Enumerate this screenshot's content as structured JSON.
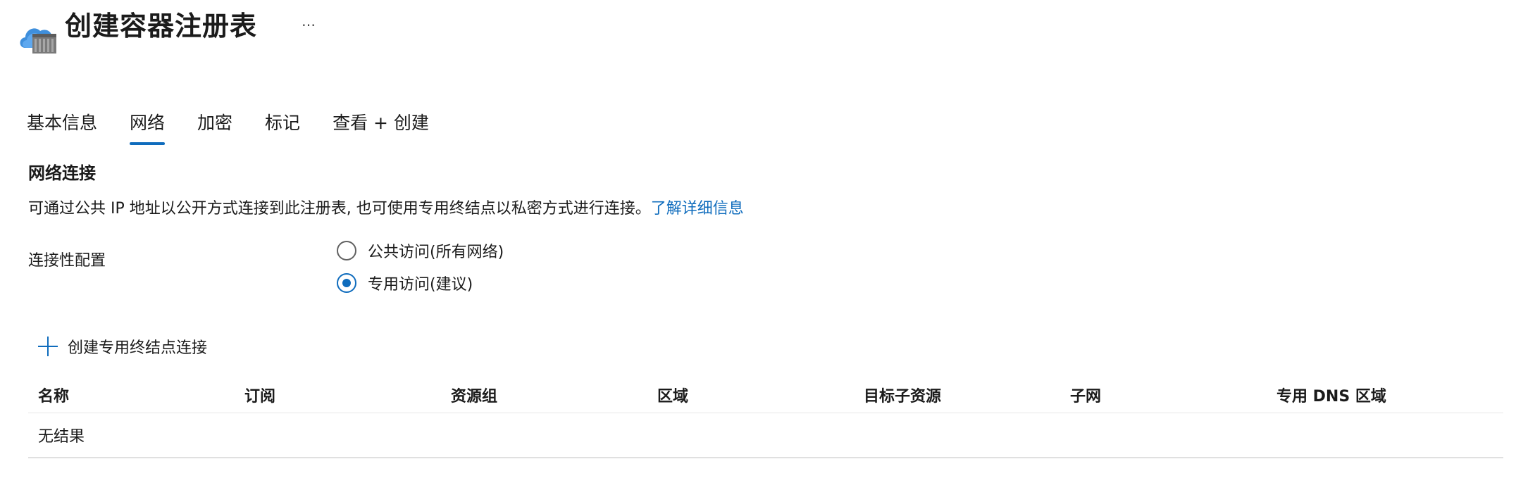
{
  "header": {
    "icon": "container-registry-cloud-icon",
    "title": "创建容器注册表",
    "more": "…"
  },
  "tabs": [
    {
      "label": "基本信息"
    },
    {
      "label": "网络",
      "active": true
    },
    {
      "label": "加密"
    },
    {
      "label": "标记"
    },
    {
      "label": "查看 + 创建"
    }
  ],
  "network": {
    "section_title": "网络连接",
    "description": "可通过公共 IP 地址以公开方式连接到此注册表, 也可使用专用终结点以私密方式进行连接。",
    "learn_more": "了解详细信息",
    "connectivity_label": "连接性配置",
    "options": [
      {
        "label": "公共访问(所有网络)",
        "selected": false
      },
      {
        "label": "专用访问(建议)",
        "selected": true
      }
    ]
  },
  "endpoints": {
    "add_label": "创建专用终结点连接",
    "columns": [
      "名称",
      "订阅",
      "资源组",
      "区域",
      "目标子资源",
      "子网",
      "专用 DNS 区域"
    ],
    "empty_text": "无结果"
  },
  "colors": {
    "accent": "#0f6cbd"
  }
}
